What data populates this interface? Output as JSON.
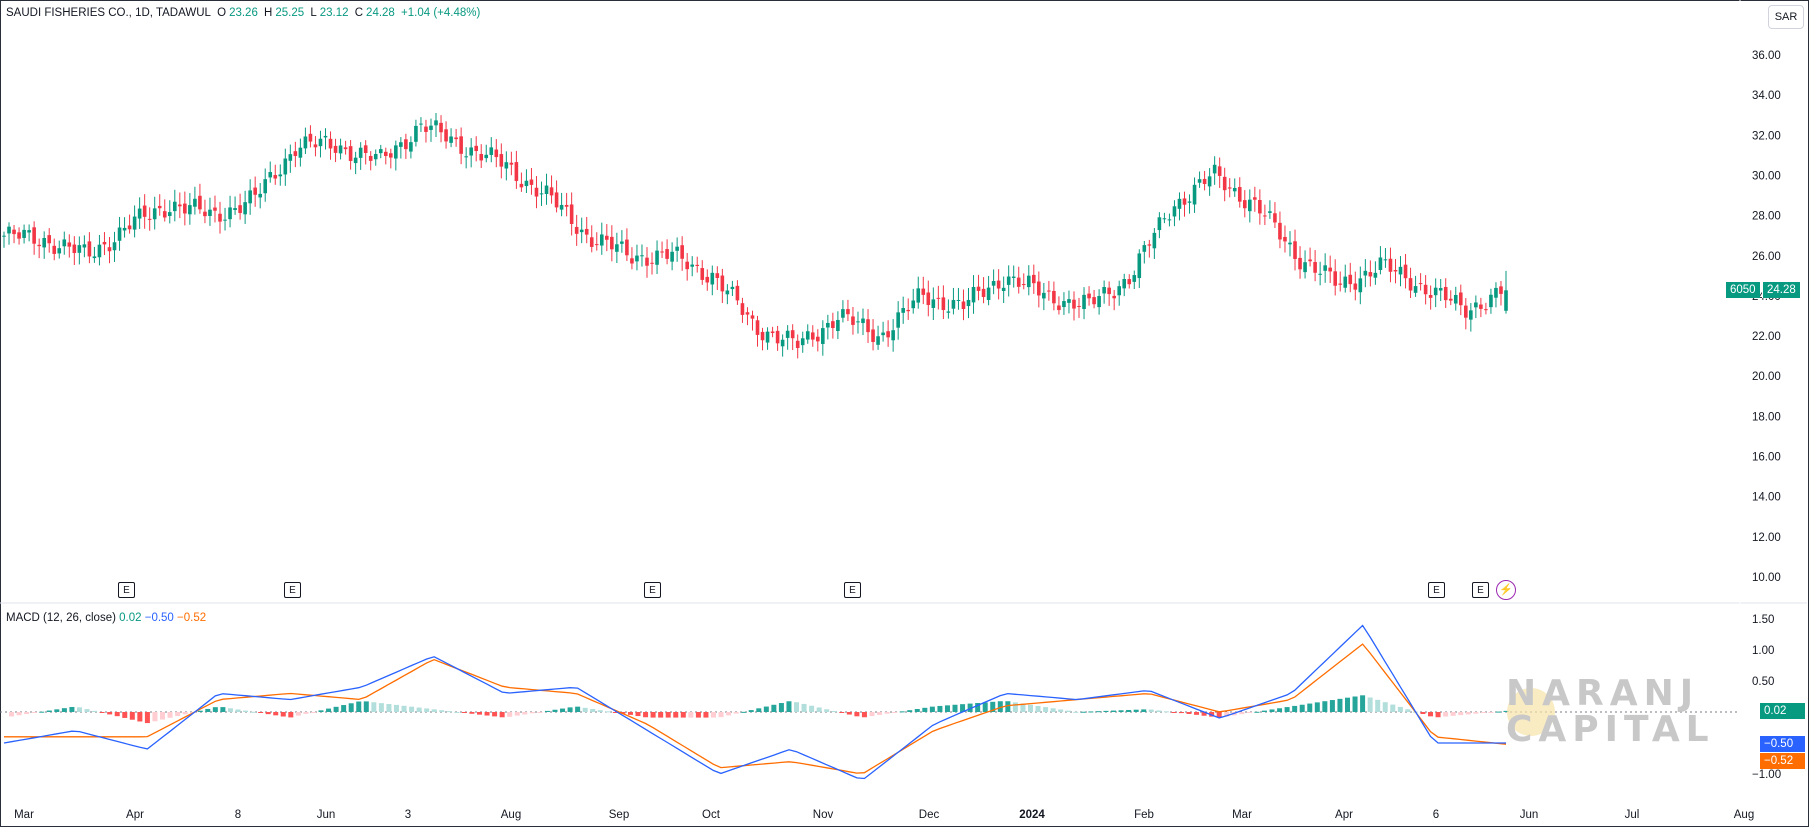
{
  "legend": {
    "symbol": "SAUDI FISHERIES CO., 1D, TADAWUL",
    "o_label": "O",
    "o": "23.26",
    "h_label": "H",
    "h": "25.25",
    "l_label": "L",
    "l": "23.12",
    "c_label": "C",
    "c": "24.28",
    "change": "+1.04 (+4.48%)"
  },
  "currency": "SAR",
  "macd_legend": {
    "label": "MACD (12, 26, close)",
    "hist": "0.02",
    "macd": "−0.50",
    "signal": "−0.52"
  },
  "price_tags": {
    "symbol_code": "6050",
    "last_price": "24.28",
    "hist": "0.02",
    "macd": "−0.50",
    "signal": "−0.52"
  },
  "watermark": {
    "line1": "NARANJ",
    "line2": "CAPITAL"
  },
  "earnings_badge": "E",
  "dividend_badge": "⚡",
  "colors": {
    "up": "#089981",
    "down": "#f23645",
    "macd": "#2962ff",
    "signal": "#ff6d00",
    "hist_up": "#26a69a",
    "hist_up_light": "#b2dfdb",
    "hist_down": "#ff5252",
    "hist_down_light": "#ffcdd2"
  },
  "chart_data": [
    {
      "type": "candlestick",
      "title": "SAUDI FISHERIES CO., 1D, TADAWUL",
      "ylim": [
        9,
        37
      ],
      "y_ticks": [
        "36.00",
        "34.00",
        "32.00",
        "30.00",
        "28.00",
        "26.00",
        "24.00",
        "22.00",
        "20.00",
        "18.00",
        "16.00",
        "14.00",
        "12.00",
        "10.00"
      ],
      "x_ticks": [
        "Mar",
        "Apr",
        "8",
        "Jun",
        "3",
        "Aug",
        "Sep",
        "Oct",
        "Nov",
        "Dec",
        "2024",
        "Feb",
        "Mar",
        "Apr",
        "6",
        "Jun",
        "Jul",
        "Aug"
      ],
      "close_anchors": [
        [
          "Mar 2023",
          27.0
        ],
        [
          "Mar 20",
          26.8
        ],
        [
          "Apr 1",
          26.0
        ],
        [
          "Apr 10",
          27.5
        ],
        [
          "Apr 25",
          28.6
        ],
        [
          "May 8",
          28.0
        ],
        [
          "May 20",
          28.8
        ],
        [
          "Jun 1",
          31.5
        ],
        [
          "Jun 20",
          31.5
        ],
        [
          "Jul 3",
          30.7
        ],
        [
          "Jul 15",
          32.5
        ],
        [
          "Jul 20",
          31.5
        ],
        [
          "Aug 1",
          30.5
        ],
        [
          "Aug 15",
          29.0
        ],
        [
          "Aug 25",
          27.0
        ],
        [
          "Sep 10",
          26.0
        ],
        [
          "Sep 25",
          26.0
        ],
        [
          "Oct 5",
          25.0
        ],
        [
          "Oct 15",
          22.5
        ],
        [
          "Oct 28",
          21.5
        ],
        [
          "Nov 5",
          23.0
        ],
        [
          "Nov 15",
          22.0
        ],
        [
          "Dec 1",
          24.0
        ],
        [
          "Dec 20",
          23.5
        ],
        [
          "Jan 5 2024",
          25.0
        ],
        [
          "Jan 20",
          24.0
        ],
        [
          "Feb 1",
          23.5
        ],
        [
          "Feb 20",
          25.0
        ],
        [
          "Mar 5",
          28.5
        ],
        [
          "Mar 10",
          30.0
        ],
        [
          "Mar 20",
          28.5
        ],
        [
          "Apr 1",
          26.0
        ],
        [
          "Apr 10",
          24.5
        ],
        [
          "Apr 25",
          25.5
        ],
        [
          "May 10",
          24.5
        ],
        [
          "May 25",
          23.3
        ],
        [
          "May 27",
          24.28
        ]
      ],
      "last": {
        "open": 23.26,
        "high": 25.25,
        "low": 23.12,
        "close": 24.28
      }
    },
    {
      "type": "line",
      "title": "MACD (12, 26, close)",
      "ylim": [
        -1.3,
        1.6
      ],
      "y_ticks": [
        "1.50",
        "1.00",
        "0.50",
        "−1.00"
      ],
      "series": [
        {
          "name": "MACD",
          "values_anchor": [
            -0.5,
            -0.3,
            -0.6,
            0.3,
            0.2,
            0.4,
            0.9,
            0.3,
            0.4,
            -0.3,
            -1.0,
            -0.6,
            -1.1,
            -0.2,
            0.3,
            0.2,
            0.35,
            -0.1,
            0.3,
            1.4,
            -0.5,
            -0.5
          ]
        },
        {
          "name": "Signal",
          "values_anchor": [
            -0.4,
            -0.4,
            -0.4,
            0.2,
            0.3,
            0.2,
            0.85,
            0.4,
            0.3,
            -0.2,
            -0.9,
            -0.8,
            -1.0,
            -0.3,
            0.1,
            0.2,
            0.3,
            0.0,
            0.2,
            1.1,
            -0.4,
            -0.52
          ]
        }
      ]
    }
  ]
}
